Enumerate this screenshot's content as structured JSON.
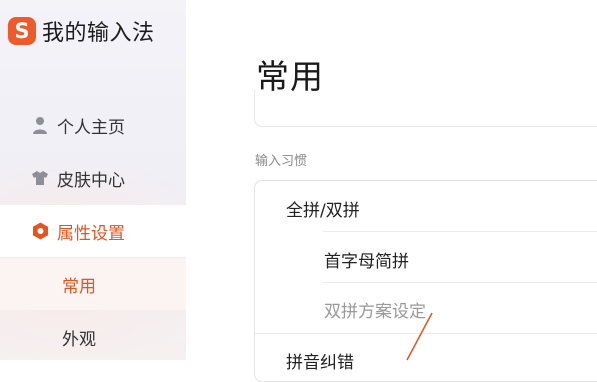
{
  "app": {
    "logo_letter": "S",
    "name": "我的输入法"
  },
  "sidebar": {
    "items": [
      {
        "label": "个人主页",
        "icon": "user-icon"
      },
      {
        "label": "皮肤中心",
        "icon": "shirt-icon"
      },
      {
        "label": "属性设置",
        "icon": "hexagon-settings-icon",
        "active": true
      }
    ],
    "subitems": [
      {
        "label": "常用",
        "current": true
      },
      {
        "label": "外观"
      }
    ]
  },
  "main": {
    "title": "常用",
    "section_label": "输入习惯",
    "rows": [
      {
        "label": "全拼/双拼"
      },
      {
        "label": "首字母简拼"
      },
      {
        "label": "双拼方案设定",
        "disabled": true
      },
      {
        "label": "拼音纠错"
      }
    ]
  },
  "colors": {
    "accent": "#e8541e",
    "logo": "#f05a28"
  }
}
